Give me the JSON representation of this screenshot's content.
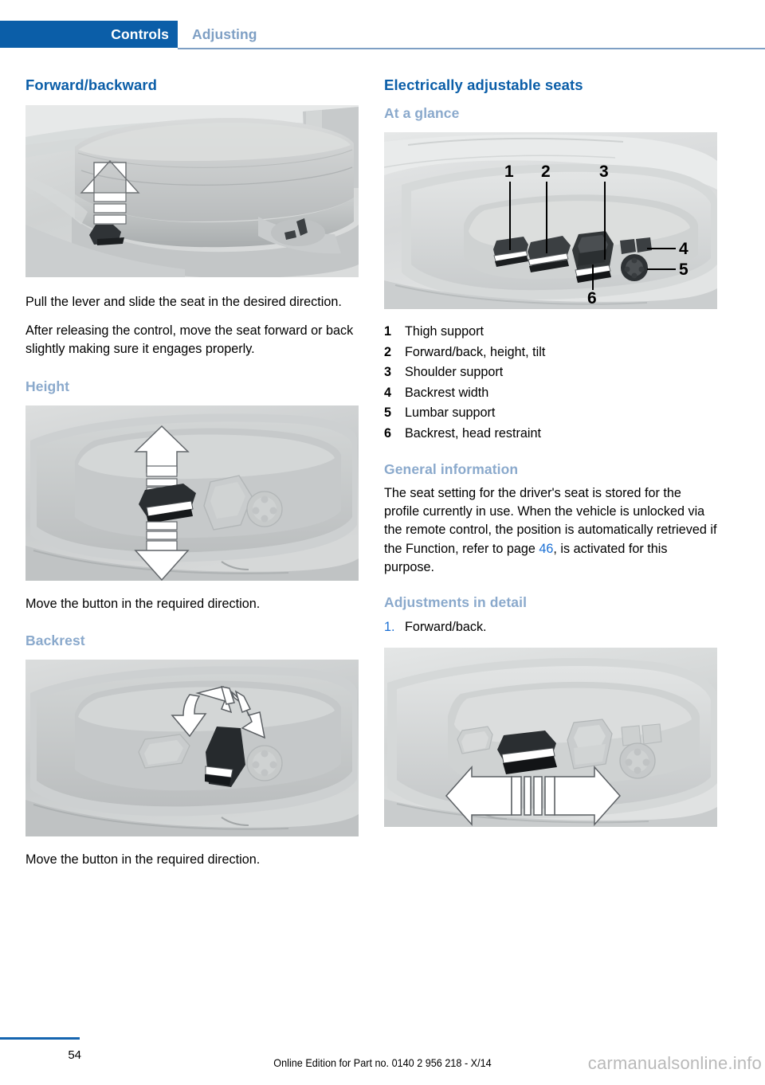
{
  "header": {
    "active_tab": "Controls",
    "inactive_tab": "Adjusting"
  },
  "left_column": {
    "section_1_title": "Forward/backward",
    "figure_1_caption": "seat-cushion-with-release-lever-illustration",
    "paragraph_1": "Pull the lever and slide the seat in the desired direction.",
    "paragraph_2": "After releasing the control, move the seat forward or back slightly making sure it engages properly.",
    "section_2_title": "Height",
    "figure_2_caption": "seat-height-rocker-switch-up-down-arrows",
    "caption_2": "Move the button in the required direction.",
    "section_3_title": "Backrest",
    "figure_3_caption": "backrest-tilt-switch-left-right-arrows",
    "caption_3": "Move the button in the required direction."
  },
  "right_column": {
    "section_title": "Electrically adjustable seats",
    "at_a_glance_title": "At a glance",
    "figure_overview_caption": "seat-control-panel-with-six-numbered-callouts",
    "callouts": [
      {
        "num": "1",
        "label": "Thigh support"
      },
      {
        "num": "2",
        "label": "Forward/back, height, tilt"
      },
      {
        "num": "3",
        "label": "Shoulder support"
      },
      {
        "num": "4",
        "label": "Backrest width"
      },
      {
        "num": "5",
        "label": "Lumbar support"
      },
      {
        "num": "6",
        "label": "Backrest, head restraint"
      }
    ],
    "general_info_title": "General information",
    "general_info_text_a": "The seat setting for the driver's seat is stored for the profile currently in use. When the vehicle is unlocked via the remote control, the position is automatically retrieved if the Function, refer to page ",
    "general_info_page_ref": "46",
    "general_info_text_b": ", is activated for this purpose.",
    "adjustments_title": "Adjustments in detail",
    "step_1_num": "1.",
    "step_1_label": "Forward/back.",
    "figure_step1_caption": "seat-forward-back-switch-with-left-right-arrows"
  },
  "footer": {
    "page_number": "54",
    "edition_text": "Online Edition for Part no. 0140 2 956 218 - X/14",
    "watermark": "carmanualsonline.info"
  },
  "colors": {
    "tab_blue": "#0b5ea8",
    "heading_blue": "#0b5ea8",
    "subheading_blue": "#8aa9cc",
    "link_blue": "#1a6fd4",
    "rule_blue": "#7e9fc4",
    "footer_rule": "#1565b0",
    "watermark_gray": "#b9b9b9"
  }
}
